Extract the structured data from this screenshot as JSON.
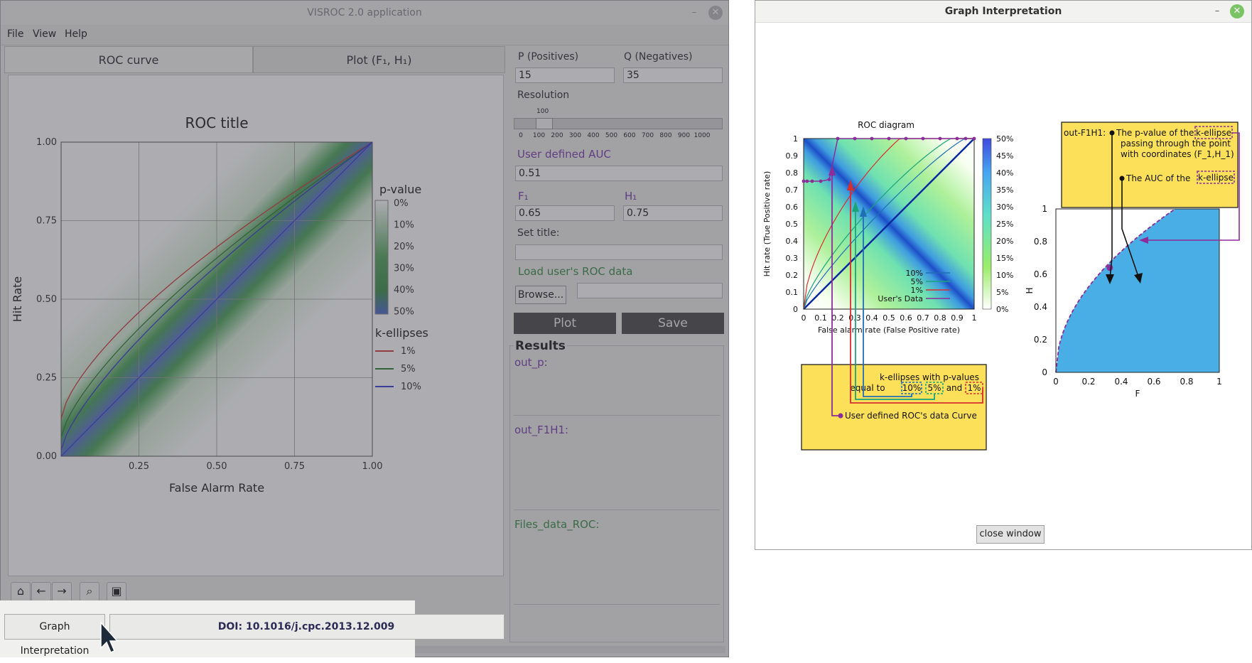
{
  "main_window": {
    "title": "VISROC 2.0 application",
    "menu": [
      "File",
      "View",
      "Help"
    ],
    "tabs": [
      "ROC curve",
      "Plot (F₁, H₁)"
    ],
    "chart_data": {
      "type": "heatmap",
      "title": "ROC title",
      "xlabel": "False Alarm Rate",
      "ylabel": "Hit Rate",
      "xlim": [
        0,
        1
      ],
      "ylim": [
        0,
        1
      ],
      "x_ticks": [
        "0.25",
        "0.50",
        "0.75",
        "1.00"
      ],
      "y_ticks": [
        "0.00",
        "0.25",
        "0.50",
        "0.75",
        "1.00"
      ],
      "grid": true,
      "pvalue_legend": {
        "title": "p-value",
        "labels": [
          "0%",
          "10%",
          "20%",
          "30%",
          "40%",
          "50%"
        ]
      },
      "kellipse_legend": {
        "title": "k-ellipses",
        "entries": [
          {
            "label": "1%",
            "color": "#d23a3a"
          },
          {
            "label": "5%",
            "color": "#2e7d32"
          },
          {
            "label": "10%",
            "color": "#3a3ad2"
          }
        ]
      },
      "curves": [
        {
          "name": "1%",
          "color": "#d23a3a",
          "y_at_x0": 0.12
        },
        {
          "name": "5%",
          "color": "#2e7d32",
          "y_at_x0": 0.06
        },
        {
          "name": "10%",
          "color": "#3a3ad2",
          "y_at_x0": 0.02
        }
      ]
    },
    "form": {
      "p_label": "P (Positives)",
      "p_value": "15",
      "q_label": "Q (Negatives)",
      "q_value": "35",
      "resolution_label": "Resolution",
      "slider_value": "100",
      "slider_ticks": [
        "0",
        "100",
        "200",
        "300",
        "400",
        "500",
        "600",
        "700",
        "800",
        "900",
        "1000"
      ],
      "auc_label": "User defined AUC",
      "auc_value": "0.51",
      "f1_label": "F₁",
      "f1_value": "0.65",
      "h1_label": "H₁",
      "h1_value": "0.75",
      "title_label": "Set title:",
      "title_value": "",
      "load_label": "Load user's ROC data",
      "browse_label": "Browse...",
      "file_value": "",
      "plot_label": "Plot",
      "save_label": "Save"
    },
    "results": {
      "title": "Results",
      "out_p": "out_p:",
      "out_f1h1": "out_F1H1:",
      "files": "Files_data_ROC:"
    },
    "graph_interp_label": "Graph Interpretation",
    "doi": "DOI: 10.1016/j.cpc.2013.12.009"
  },
  "dialog": {
    "title": "Graph Interpretation",
    "close_label": "close window",
    "roc": {
      "title": "ROC diagram",
      "xlabel": "False alarm rate (False Positive rate)",
      "ylabel": "Hit rate (True Positive rate)",
      "x_ticks": [
        "0",
        "0.1",
        "0.2",
        "0.3",
        "0.4",
        "0.5",
        "0.6",
        "0.7",
        "0.8",
        "0.9",
        "1"
      ],
      "y_ticks": [
        "0",
        "0.1",
        "0.2",
        "0.3",
        "0.4",
        "0.5",
        "0.6",
        "0.7",
        "0.8",
        "0.9",
        "1"
      ],
      "colorbar": [
        "50%",
        "45%",
        "40%",
        "35%",
        "30%",
        "25%",
        "20%",
        "15%",
        "10%",
        "5%",
        "0%"
      ],
      "legend": [
        {
          "label": "10%",
          "color": "#1f6fb5"
        },
        {
          "label": "5%",
          "color": "#1aa37a"
        },
        {
          "label": "1%",
          "color": "#d62f2f"
        },
        {
          "label": "User's Data",
          "color": "#8b2d9a"
        }
      ],
      "user_data": [
        [
          0,
          0.75
        ],
        [
          0.02,
          0.75
        ],
        [
          0.05,
          0.75
        ],
        [
          0.1,
          0.75
        ],
        [
          0.15,
          0.76
        ],
        [
          0.2,
          1
        ],
        [
          0.3,
          1
        ],
        [
          0.4,
          1
        ],
        [
          0.5,
          1
        ],
        [
          0.6,
          1
        ],
        [
          0.7,
          1
        ],
        [
          0.8,
          1
        ],
        [
          0.9,
          1
        ],
        [
          0.95,
          1
        ],
        [
          1,
          1
        ]
      ]
    },
    "callout_bottom": {
      "line1": "k-ellipses with p-values",
      "line2_prefix": "equal to",
      "p10": "10%",
      "p5": "5%",
      "and": "and",
      "p1": "1%",
      "curve_label": "User defined ROC's data Curve"
    },
    "callout_right": {
      "head": "out-F1H1:",
      "line1": "The p-value of the",
      "kellipse": "k-ellipse",
      "line2": "passing through the point",
      "line3": "with coordinates (F_1,H_1)",
      "line4": "The  AUC of the",
      "kellipse2": "k-ellipse"
    },
    "fh": {
      "xlabel": "F",
      "ylabel": "H",
      "x_ticks": [
        "0",
        "0.2",
        "0.4",
        "0.6",
        "0.8",
        "1"
      ],
      "y_ticks": [
        "0",
        "0.2",
        "0.4",
        "0.6",
        "0.8",
        "1"
      ]
    }
  }
}
